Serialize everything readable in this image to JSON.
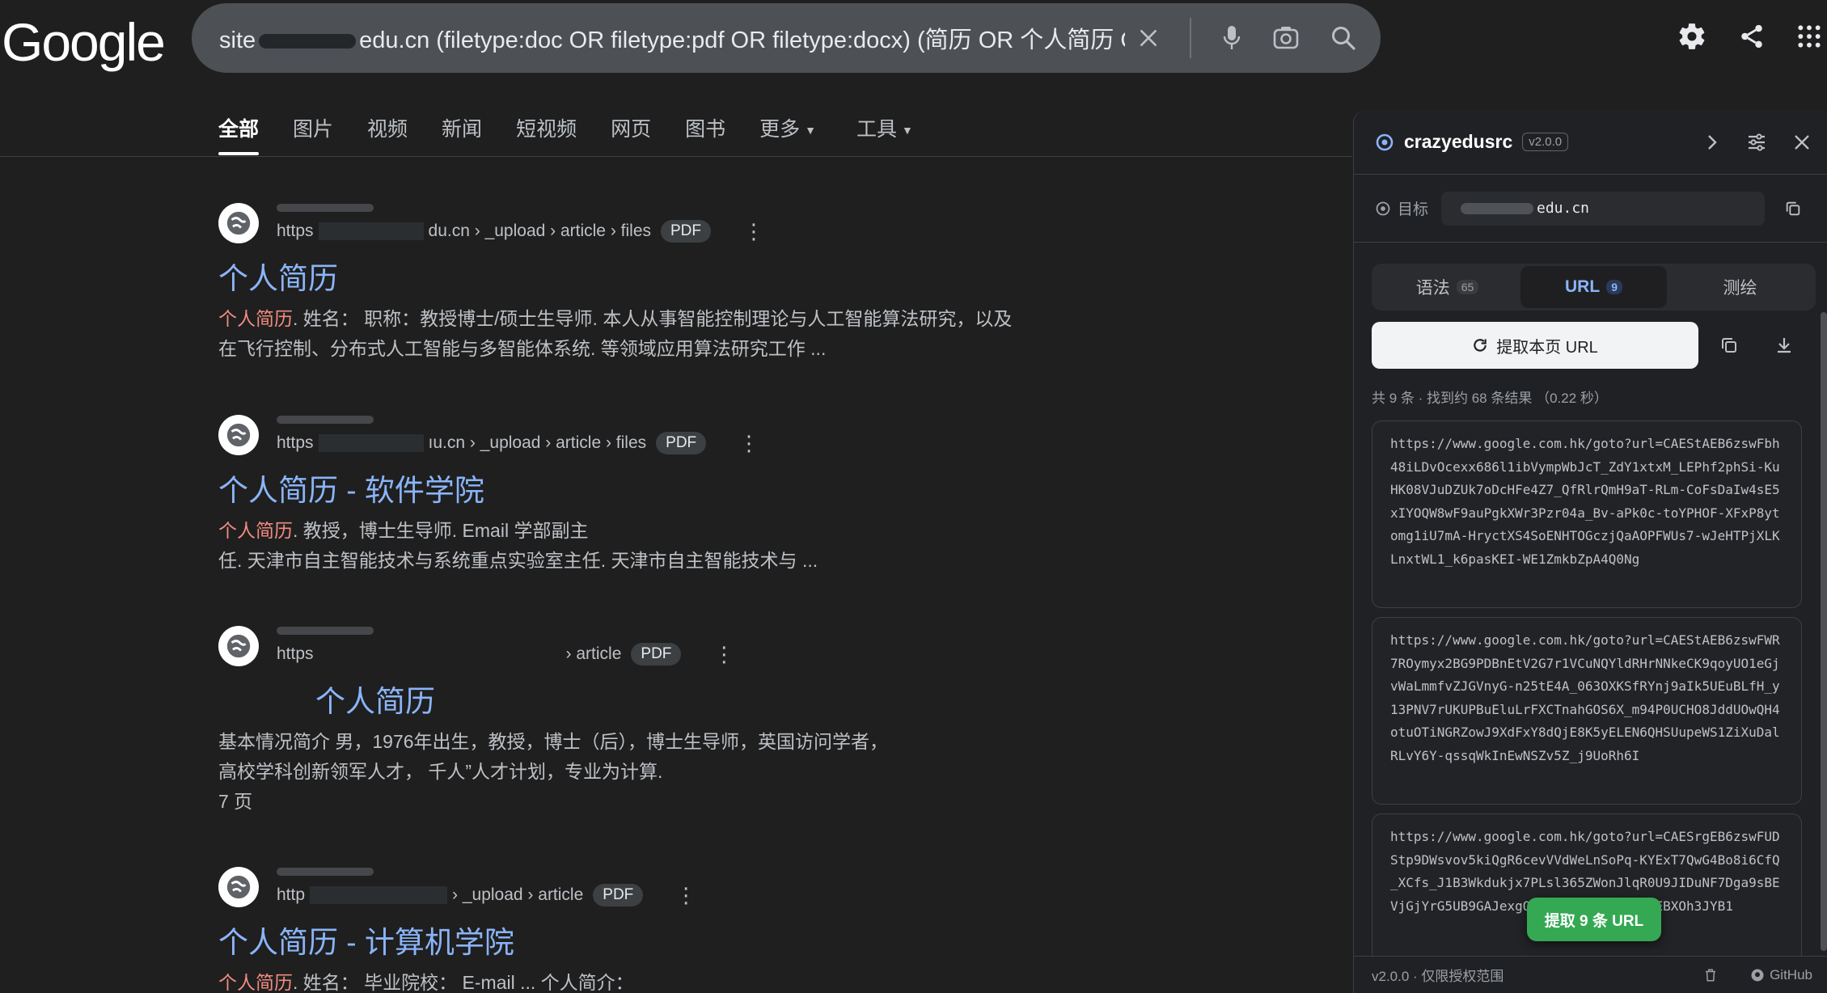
{
  "header": {
    "logo": "Google",
    "search_prefix": "site",
    "search_suffix": "edu.cn (filetype:doc OR filetype:pdf OR filetype:docx) (简历 OR 个人简历 OR 履"
  },
  "tabs": [
    {
      "label": "全部"
    },
    {
      "label": "图片"
    },
    {
      "label": "视频"
    },
    {
      "label": "新闻"
    },
    {
      "label": "短视频"
    },
    {
      "label": "网页"
    },
    {
      "label": "图书"
    },
    {
      "label": "更多"
    },
    {
      "label": "工具"
    }
  ],
  "results": [
    {
      "url_prefix": "https",
      "url_path": "du.cn › _upload › article › files",
      "badge": "PDF",
      "title": "个人简历",
      "snippet_hl": "个人简历",
      "snippet_1": ". 姓名：    职称：教授博士/硕士生导师. 本人从事智能控制理论与人工智能算法研究，以及",
      "snippet_2": "在飞行控制、分布式人工智能与多智能体系统. 等领域应用算法研究工作 ..."
    },
    {
      "url_prefix": "https",
      "url_path": "ıu.cn › _upload › article › files",
      "badge": "PDF",
      "title": "个人简历 - 软件学院",
      "snippet_hl": "个人简历",
      "snippet_1": ".          教授，博士生导师. Email                                     学部副主",
      "snippet_2": "任. 天津市自主智能技术与系统重点实验室主任. 天津市自主智能技术与 ..."
    },
    {
      "url_prefix": "https",
      "url_path": "› article",
      "badge": "PDF",
      "title": "个人简历",
      "snippet_1": "基本情况简介             男，1976年出生，教授，博士（后），博士生导师，英国访问学者，",
      "snippet_2": "高校学科创新领军人才，          千人”人才计划，专业为计算.",
      "pages": "7 页"
    },
    {
      "url_prefix": "http",
      "url_path": "› _upload › article",
      "badge": "PDF",
      "title": "个人简历 - 计算机学院",
      "snippet_hl": "个人简历",
      "snippet_1": ". 姓名：                          毕业院校：               E-mail ... 个人简介："
    }
  ],
  "panel": {
    "brand": "crazyedusrc",
    "version": "v2.0.0",
    "target_label": "目标",
    "target_value": "edu.cn",
    "tabs": [
      {
        "label": "语法",
        "count": "65"
      },
      {
        "label": "URL",
        "count": "9"
      },
      {
        "label": "测绘"
      }
    ],
    "extract_label": "提取本页 URL",
    "stats": "共 9 条 · 找到约 68 条结果 （0.22 秒）",
    "urls": [
      "https://www.google.com.hk/goto?url=CAEStAEB6zswFbh48iLDvOcexx686l1ibVympWbJcT_ZdY1xtxM_LEPhf2phSi-KuHK08VJuDZUk7oDcHFe4Z7_QfRlrQmH9aT-RLm-CoFsDaIw4sE5xIYOQW8wF9auPgkXWr3Pzr04a_Bv-aPk0c-toYPHOF-XFxP8ytomg1iU7mA-HryctXS4SoENHTOGczjQaAOPFWUs7-wJeHTPjXLKLnxtWL1_k6pasKEI-WE1ZmkbZpA4Q0Ng",
      "https://www.google.com.hk/goto?url=CAEStAEB6zswFWR7ROymyx2BG9PDBnEtV2G7r1VCuNQYldRHrNNkeCK9qoyUO1eGjvWaLmmfvZJGVnyG-n25tE4A_063OXKSfRYnj9aIk5UEuBLfH_y13PNV7rUKUPBuEluLrFXCTnahGOS6X_m94P0UCHO8JddUOwQH4otuOTiNGRZowJ9XdFxY8dQjE8K5yELEN6QHSUupeWS1ZiXuDalRLvY6Y-qssqWkInEwNSZv5Z_j9UoRh6I",
      "https://www.google.com.hk/goto?url=CAESrgEB6zswFUDStp9DWsvov5kiQgR6cevVVdWeLnSoPq-KYExT7QwG4Bo8i6CfQ_XCfs_J1B3Wkdukjx7PLsl365ZWonJlqR0U9JIDuNF7Dga9sBEVjGjYrG5UB9GAJexgQd8YH-yF0s7FHcL0pEBXOh3JYB1"
    ],
    "float_label": "提取 9 条 URL",
    "footer_left": "v2.0.0 · 仅限授权范围",
    "footer_right": "GitHub"
  }
}
